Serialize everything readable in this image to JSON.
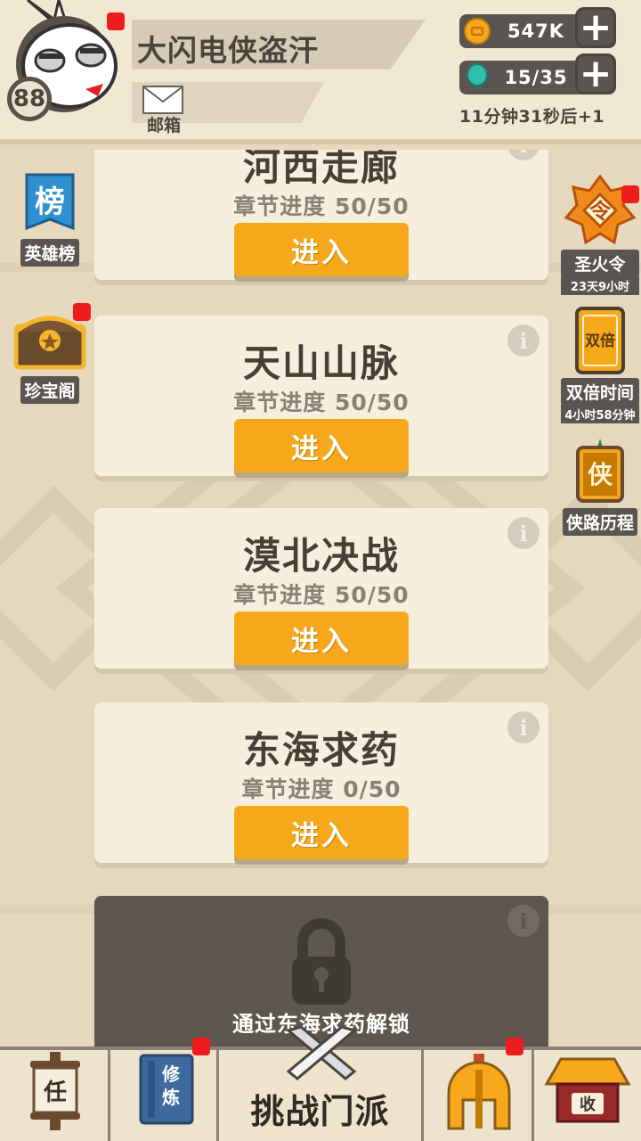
{
  "header": {
    "level": "88",
    "player_name": "大闪电侠盗汗",
    "mail_label": "邮箱",
    "gold": "547K",
    "energy": "15/35",
    "energy_timer": "11分钟31秒后+1"
  },
  "left_sidebar": {
    "hero_rank": {
      "label": "英雄榜",
      "glyph": "榜"
    },
    "treasure": {
      "label": "珍宝阁"
    }
  },
  "right_sidebar": {
    "sacred_fire": {
      "label": "圣火令",
      "sub": "23天9小时",
      "glyph": "令"
    },
    "double_time": {
      "label": "双倍时间",
      "sub": "4小时58分钟",
      "glyph": "双倍"
    },
    "hero_journey": {
      "label": "侠路历程",
      "glyph": "侠"
    }
  },
  "chapters": [
    {
      "title": "河西走廊",
      "progress": "章节进度 50/50",
      "button": "进入"
    },
    {
      "title": "天山山脉",
      "progress": "章节进度 50/50",
      "button": "进入"
    },
    {
      "title": "漠北决战",
      "progress": "章节进度 50/50",
      "button": "进入"
    },
    {
      "title": "东海求药",
      "progress": "章节进度 0/50",
      "button": "进入"
    }
  ],
  "locked_chapter": {
    "unlock_text": "通过东海求药解锁"
  },
  "info_glyph": "i",
  "bottom_nav": {
    "task_glyph": "任",
    "cultivate_glyph_1": "修",
    "cultivate_glyph_2": "炼",
    "challenge_label": "挑战门派",
    "collect_glyph": "收"
  },
  "colors": {
    "accent_button": "#f6a81a",
    "badge_red": "#ee1c1c",
    "dark_panel": "#5e5750"
  }
}
